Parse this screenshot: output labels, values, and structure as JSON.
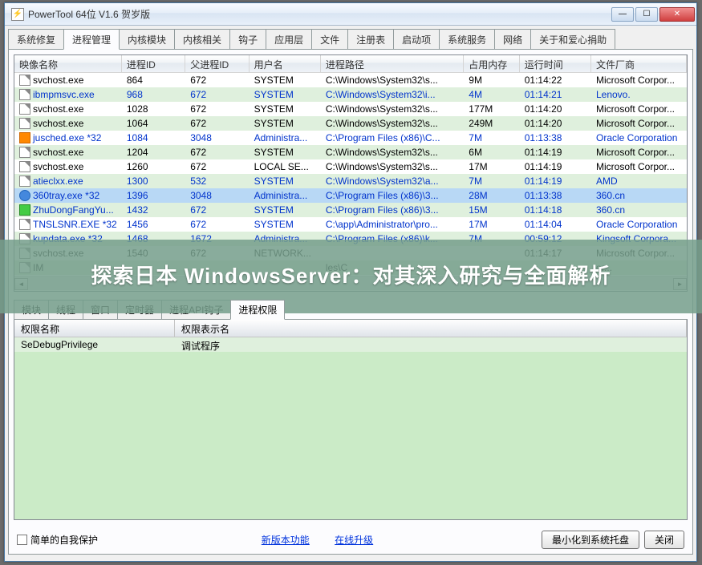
{
  "window": {
    "title": "PowerTool 64位 V1.6 贺岁版"
  },
  "main_tabs": [
    "系统修复",
    "进程管理",
    "内核模块",
    "内核相关",
    "钩子",
    "应用层",
    "文件",
    "注册表",
    "启动项",
    "系统服务",
    "网络",
    "关于和爱心捐助"
  ],
  "main_tab_active": 1,
  "columns": {
    "name": "映像名称",
    "pid": "进程ID",
    "ppid": "父进程ID",
    "user": "用户名",
    "path": "进程路径",
    "mem": "占用内存",
    "time": "运行时间",
    "vendor": "文件厂商"
  },
  "rows": [
    {
      "icon": "file",
      "name": "svchost.exe",
      "pid": "864",
      "ppid": "672",
      "user": "SYSTEM",
      "path": "C:\\Windows\\System32\\s...",
      "mem": "9M",
      "time": "01:14:22",
      "vendor": "Microsoft Corpor...",
      "blue": false
    },
    {
      "icon": "file",
      "name": "ibmpmsvc.exe",
      "pid": "968",
      "ppid": "672",
      "user": "SYSTEM",
      "path": "C:\\Windows\\System32\\i...",
      "mem": "4M",
      "time": "01:14:21",
      "vendor": "Lenovo.",
      "blue": true
    },
    {
      "icon": "file",
      "name": "svchost.exe",
      "pid": "1028",
      "ppid": "672",
      "user": "SYSTEM",
      "path": "C:\\Windows\\System32\\s...",
      "mem": "177M",
      "time": "01:14:20",
      "vendor": "Microsoft Corpor...",
      "blue": false
    },
    {
      "icon": "file",
      "name": "svchost.exe",
      "pid": "1064",
      "ppid": "672",
      "user": "SYSTEM",
      "path": "C:\\Windows\\System32\\s...",
      "mem": "249M",
      "time": "01:14:20",
      "vendor": "Microsoft Corpor...",
      "blue": false
    },
    {
      "icon": "orange",
      "name": "jusched.exe *32",
      "pid": "1084",
      "ppid": "3048",
      "user": "Administra...",
      "path": "C:\\Program Files (x86)\\C...",
      "mem": "7M",
      "time": "01:13:38",
      "vendor": "Oracle Corporation",
      "blue": true
    },
    {
      "icon": "file",
      "name": "svchost.exe",
      "pid": "1204",
      "ppid": "672",
      "user": "SYSTEM",
      "path": "C:\\Windows\\System32\\s...",
      "mem": "6M",
      "time": "01:14:19",
      "vendor": "Microsoft Corpor...",
      "blue": false
    },
    {
      "icon": "file",
      "name": "svchost.exe",
      "pid": "1260",
      "ppid": "672",
      "user": "LOCAL SE...",
      "path": "C:\\Windows\\System32\\s...",
      "mem": "17M",
      "time": "01:14:19",
      "vendor": "Microsoft Corpor...",
      "blue": false
    },
    {
      "icon": "file",
      "name": "atieclxx.exe",
      "pid": "1300",
      "ppid": "532",
      "user": "SYSTEM",
      "path": "C:\\Windows\\System32\\a...",
      "mem": "7M",
      "time": "01:14:19",
      "vendor": "AMD",
      "blue": true
    },
    {
      "icon": "blue",
      "name": "360tray.exe *32",
      "pid": "1396",
      "ppid": "3048",
      "user": "Administra...",
      "path": "C:\\Program Files (x86)\\3...",
      "mem": "28M",
      "time": "01:13:38",
      "vendor": "360.cn",
      "blue": true,
      "hl": true
    },
    {
      "icon": "green",
      "name": "ZhuDongFangYu...",
      "pid": "1432",
      "ppid": "672",
      "user": "SYSTEM",
      "path": "C:\\Program Files (x86)\\3...",
      "mem": "15M",
      "time": "01:14:18",
      "vendor": "360.cn",
      "blue": true
    },
    {
      "icon": "file",
      "name": "TNSLSNR.EXE *32",
      "pid": "1456",
      "ppid": "672",
      "user": "SYSTEM",
      "path": "C:\\app\\Administrator\\pro...",
      "mem": "17M",
      "time": "01:14:04",
      "vendor": "Oracle Corporation",
      "blue": true
    },
    {
      "icon": "file",
      "name": "kupdata.exe *32",
      "pid": "1468",
      "ppid": "1672",
      "user": "Administra...",
      "path": "C:\\Program Files (x86)\\k...",
      "mem": "7M",
      "time": "00:59:12",
      "vendor": "Kingsoft Corpora...",
      "blue": true
    },
    {
      "icon": "file",
      "name": "svchost.exe",
      "pid": "1540",
      "ppid": "672",
      "user": "NETWORK...",
      "path": "",
      "mem": "",
      "time": "01:14:17",
      "vendor": "Microsoft Corpor...",
      "blue": false
    },
    {
      "icon": "file",
      "name": "IM",
      "pid": "",
      "ppid": "",
      "user": "",
      "path": "les\\C",
      "mem": "",
      "time": "",
      "vendor": "or...",
      "blue": false
    }
  ],
  "sub_tabs": [
    "模块",
    "线程",
    "窗口",
    "定时器",
    "进程API钩子",
    "进程权限"
  ],
  "sub_tab_active": 5,
  "priv_columns": {
    "name": "权限名称",
    "disp": "权限表示名"
  },
  "priv_rows": [
    {
      "name": "SeDebugPrivilege",
      "disp": "调试程序"
    }
  ],
  "bottom": {
    "self_protect": "简单的自我保护",
    "link_features": "新版本功能",
    "link_upgrade": "在线升级",
    "btn_tray": "最小化到系统托盘",
    "btn_close": "关闭"
  },
  "overlay": "探索日本 WindowsServer：对其深入研究与全面解析"
}
